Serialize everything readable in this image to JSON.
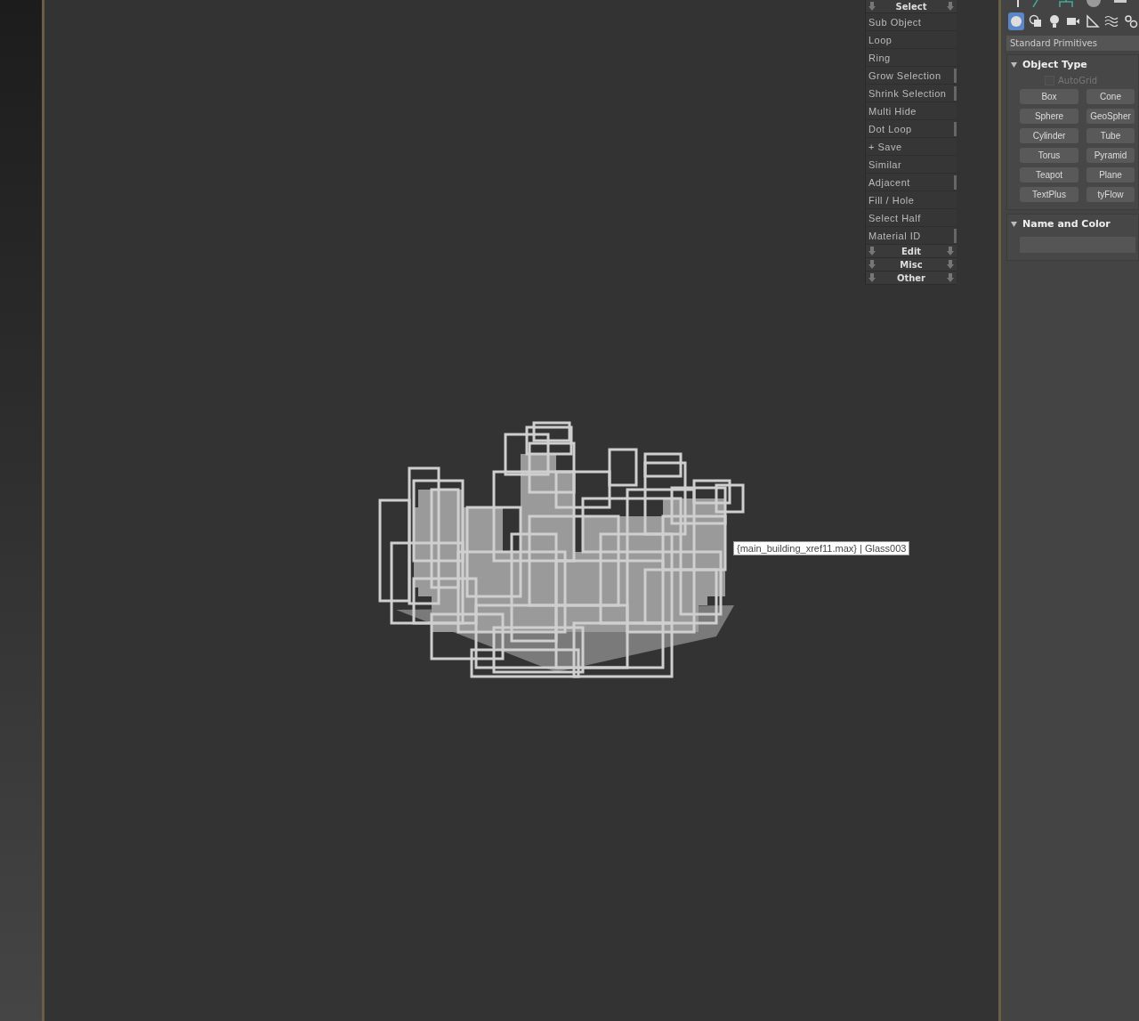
{
  "script_menu": {
    "sections": [
      {
        "title": "Select",
        "items": [
          {
            "label": "Sub Object",
            "side_tab": false
          },
          {
            "label": "Loop",
            "side_tab": false
          },
          {
            "label": "Ring",
            "side_tab": false
          },
          {
            "label": "Grow Selection",
            "side_tab": true
          },
          {
            "label": "Shrink Selection",
            "side_tab": true
          },
          {
            "label": "Multi Hide",
            "side_tab": false
          },
          {
            "label": "Dot Loop",
            "side_tab": true
          },
          {
            "label": "+ Save",
            "side_tab": false
          },
          {
            "label": "Similar",
            "side_tab": false
          },
          {
            "label": "Adjacent",
            "side_tab": true
          },
          {
            "label": "Fill / Hole",
            "side_tab": false
          },
          {
            "label": "Select Half",
            "side_tab": false
          },
          {
            "label": "Material ID",
            "side_tab": true
          }
        ]
      },
      {
        "title": "Edit"
      },
      {
        "title": "Misc"
      },
      {
        "title": "Other"
      }
    ]
  },
  "viewport": {
    "tooltip": "{main_building_xref11.max} | Glass003"
  },
  "command_panel": {
    "create_tabs": [
      {
        "kind": "geometry",
        "selected": true
      },
      {
        "kind": "shapes",
        "selected": false
      },
      {
        "kind": "lights",
        "selected": false
      },
      {
        "kind": "cameras",
        "selected": false
      },
      {
        "kind": "helpers",
        "selected": false
      },
      {
        "kind": "spacewarps",
        "selected": false
      },
      {
        "kind": "systems",
        "selected": false
      }
    ],
    "category": "Standard Primitives",
    "object_type": {
      "title": "Object Type",
      "autogrid": {
        "label": "AutoGrid",
        "checked": false,
        "disabled": true
      },
      "buttons": [
        "Box",
        "Cone",
        "Sphere",
        "GeoSpher",
        "Cylinder",
        "Tube",
        "Torus",
        "Pyramid",
        "Teapot",
        "Plane",
        "TextPlus",
        "tyFlow"
      ]
    },
    "name_and_color": {
      "title": "Name and Color"
    }
  }
}
